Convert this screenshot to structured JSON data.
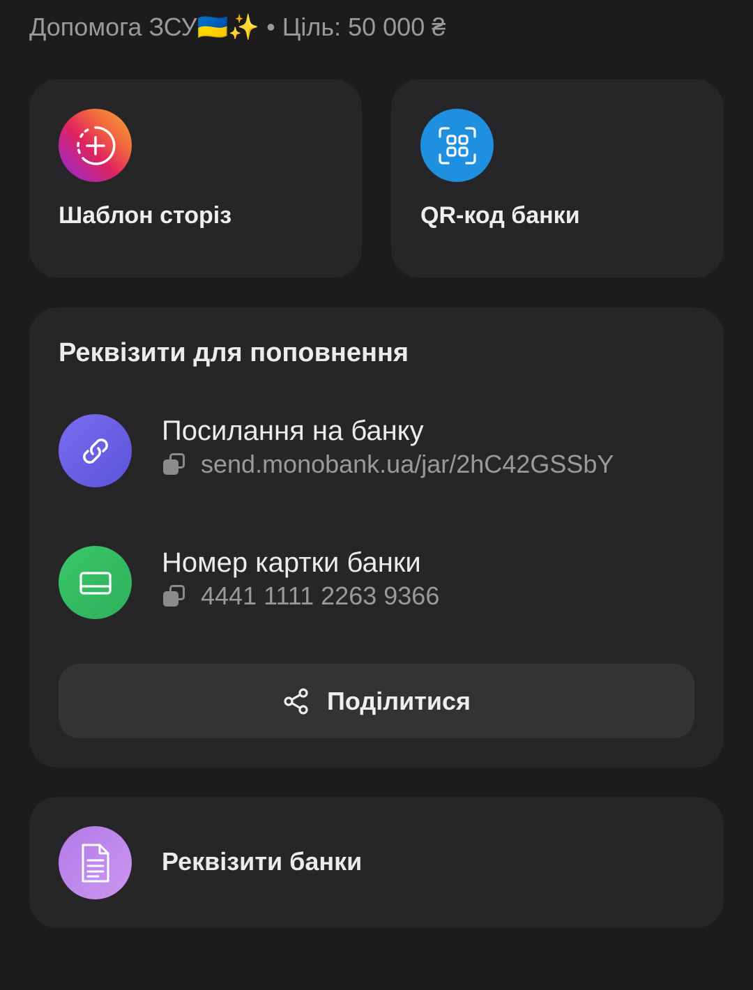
{
  "header": {
    "subtitle": "Допомога ЗСУ🇺🇦✨ • Ціль: 50 000 ₴"
  },
  "tiles": [
    {
      "label": "Шаблон сторіз",
      "icon": "story-plus-icon",
      "color": "#e0245e"
    },
    {
      "label": "QR-код банки",
      "icon": "qr-scan-icon",
      "color": "#1f8fe0"
    }
  ],
  "requisites": {
    "title": "Реквізити для поповнення",
    "link": {
      "title": "Посилання на банку",
      "value": "send.monobank.ua/jar/2hC42GSSbY",
      "icon": "link-icon",
      "color": "#6a5fe6"
    },
    "card": {
      "title": "Номер картки банки",
      "value": "4441 1111 2263 9366",
      "icon": "credit-card-icon",
      "color": "#34bc62"
    },
    "share_label": "Поділитися"
  },
  "bank_details": {
    "label": "Реквізити банки",
    "icon": "document-icon",
    "color": "#c08ced"
  }
}
